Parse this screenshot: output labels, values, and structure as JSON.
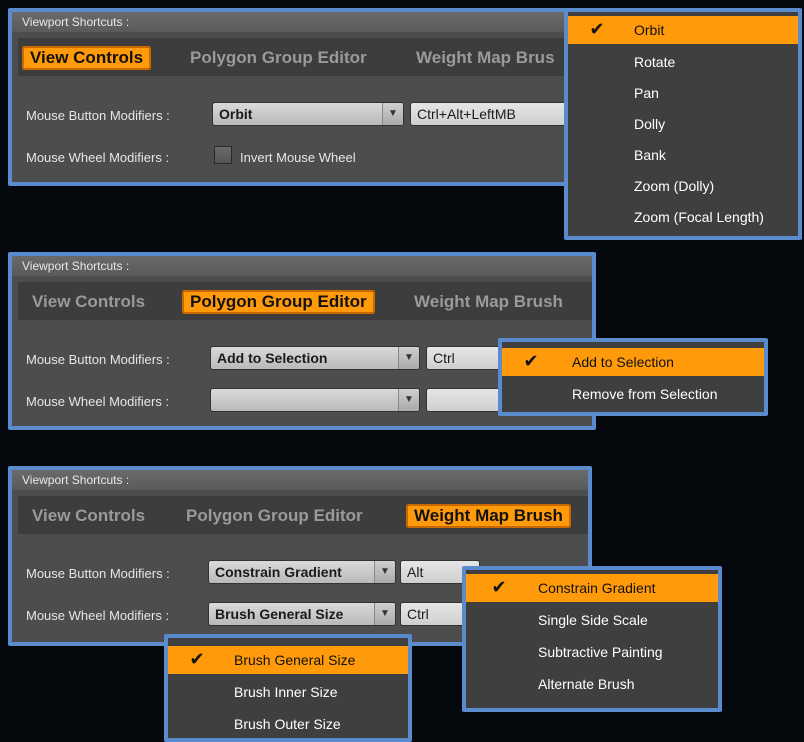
{
  "panel1": {
    "header": "Viewport Shortcuts :",
    "tabs": [
      "View Controls",
      "Polygon Group Editor",
      "Weight Map Brus"
    ],
    "rows": [
      {
        "label": "Mouse Button Modifiers :",
        "combo": "Orbit",
        "field": "Ctrl+Alt+LeftMB"
      },
      {
        "label": "Mouse Wheel Modifiers :",
        "checkbox_label": "Invert Mouse Wheel"
      }
    ],
    "menu": [
      "Orbit",
      "Rotate",
      "Pan",
      "Dolly",
      "Bank",
      "Zoom (Dolly)",
      "Zoom (Focal Length)"
    ]
  },
  "panel2": {
    "header": "Viewport Shortcuts :",
    "tabs": [
      "View Controls",
      "Polygon Group Editor",
      "Weight Map Brush"
    ],
    "rows": [
      {
        "label": "Mouse Button Modifiers :",
        "combo": "Add to Selection",
        "field": "Ctrl"
      },
      {
        "label": "Mouse Wheel Modifiers :",
        "combo": "",
        "field": ""
      }
    ],
    "menu": [
      "Add to Selection",
      "Remove from Selection"
    ]
  },
  "panel3": {
    "header": "Viewport Shortcuts :",
    "tabs": [
      "View Controls",
      "Polygon Group Editor",
      "Weight Map Brush"
    ],
    "rows": [
      {
        "label": "Mouse Button Modifiers :",
        "combo": "Constrain Gradient",
        "field": "Alt"
      },
      {
        "label": "Mouse Wheel Modifiers :",
        "combo": "Brush General Size",
        "field": "Ctrl"
      }
    ],
    "menu_button": [
      "Constrain Gradient",
      "Single Side Scale",
      "Subtractive Painting",
      "Alternate Brush"
    ],
    "menu_wheel": [
      "Brush General Size",
      "Brush Inner Size",
      "Brush Outer Size"
    ]
  },
  "icons": {
    "check": "✔",
    "dropdown_arrow": "▼"
  },
  "colors": {
    "accent": "#ff9a0a",
    "frame": "#5b8bcf",
    "panel": "#4d4d4d"
  }
}
